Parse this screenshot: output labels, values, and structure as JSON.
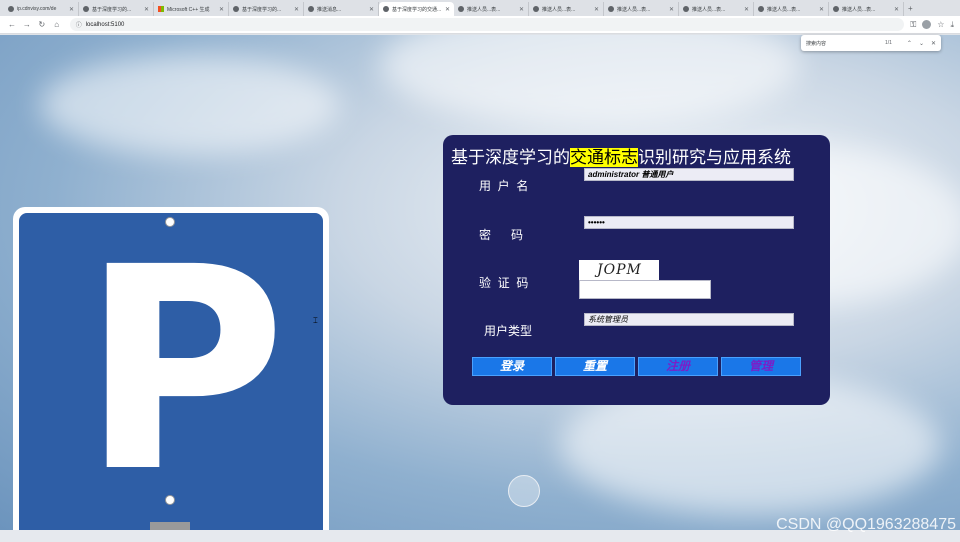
{
  "browser": {
    "tabs": [
      {
        "label": "ip.cdnvisy.com/de"
      },
      {
        "label": "基于深度学习的..."
      },
      {
        "label": "Microsoft C++ 生成"
      },
      {
        "label": "基于深度学习的..."
      },
      {
        "label": "推送消息..."
      },
      {
        "label": "基于深度学习的交通..."
      },
      {
        "label": "推送人员...表..."
      },
      {
        "label": "推送人员...表..."
      },
      {
        "label": "推送人员...表..."
      },
      {
        "label": "推送人员...表..."
      },
      {
        "label": "推送人员...表..."
      },
      {
        "label": "推送人员...表..."
      }
    ],
    "active_tab_index": 5,
    "new_tab_symbol": "+",
    "url": "localhost:5100",
    "find": {
      "query": "搜索内容",
      "count": "1/1"
    }
  },
  "page": {
    "login": {
      "title_before": "基于深度学习的",
      "title_highlight": "交通标志",
      "title_after": "识别研究与应用系统",
      "username_label": "用  户  名",
      "username_value": "administrator 普通用户",
      "password_label": "密      码",
      "password_value": "••••••",
      "captcha_label": "验  证  码",
      "captcha_text": "JOPM",
      "captcha_input": "",
      "usertype_label": "用户类型",
      "usertype_value": "系统管理员",
      "buttons": {
        "login": "登录",
        "reset": "重置",
        "register": "注册",
        "manage": "管理"
      }
    },
    "sign_letter": "P",
    "watermark": "CSDN @QQ1963288475"
  },
  "colors": {
    "panel_bg": "#1e2060",
    "button_bg": "#1a77e8",
    "highlight": "#ffff00",
    "sign_blue": "#2e5ea6"
  }
}
